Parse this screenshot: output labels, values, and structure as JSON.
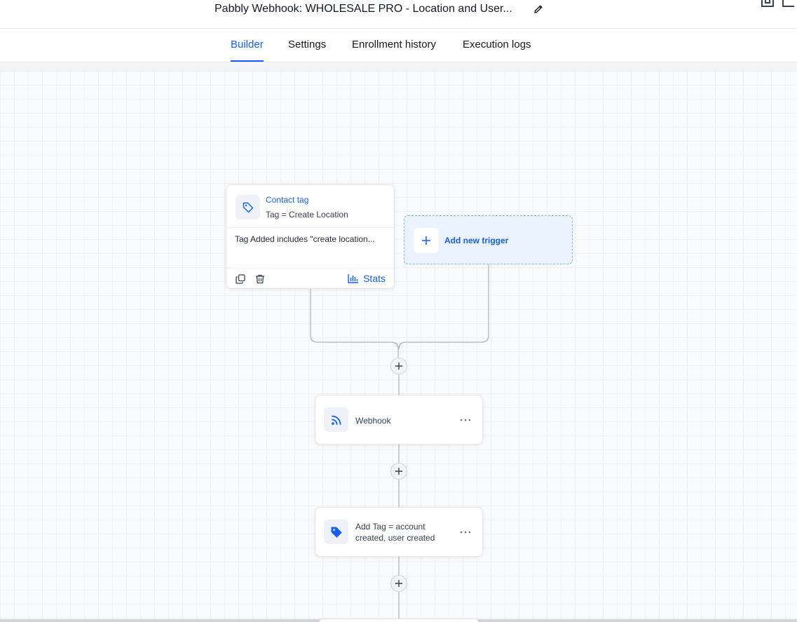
{
  "header": {
    "title": "Pabbly Webhook:  WHOLESALE PRO - Location and User...",
    "edit_icon": "pencil-icon"
  },
  "tabs": [
    {
      "label": "Builder",
      "active": true
    },
    {
      "label": "Settings",
      "active": false
    },
    {
      "label": "Enrollment history",
      "active": false
    },
    {
      "label": "Execution logs",
      "active": false
    }
  ],
  "trigger": {
    "icon": "tag-outline-icon",
    "title": "Contact tag",
    "subtitle": "Tag = Create Location",
    "description": "Tag Added includes \"create location...",
    "stats_label": "Stats"
  },
  "add_trigger": {
    "label": "Add new trigger"
  },
  "steps": [
    {
      "icon": "webhook-icon",
      "label": "Webhook"
    },
    {
      "icon": "tag-filled-icon",
      "label_line1": "Add Tag = account",
      "label_line2": "created, user created"
    }
  ],
  "colors": {
    "accent": "#155eef",
    "add_trigger_bg": "#eaf3ff",
    "canvas_bg": "#f9fafb"
  }
}
